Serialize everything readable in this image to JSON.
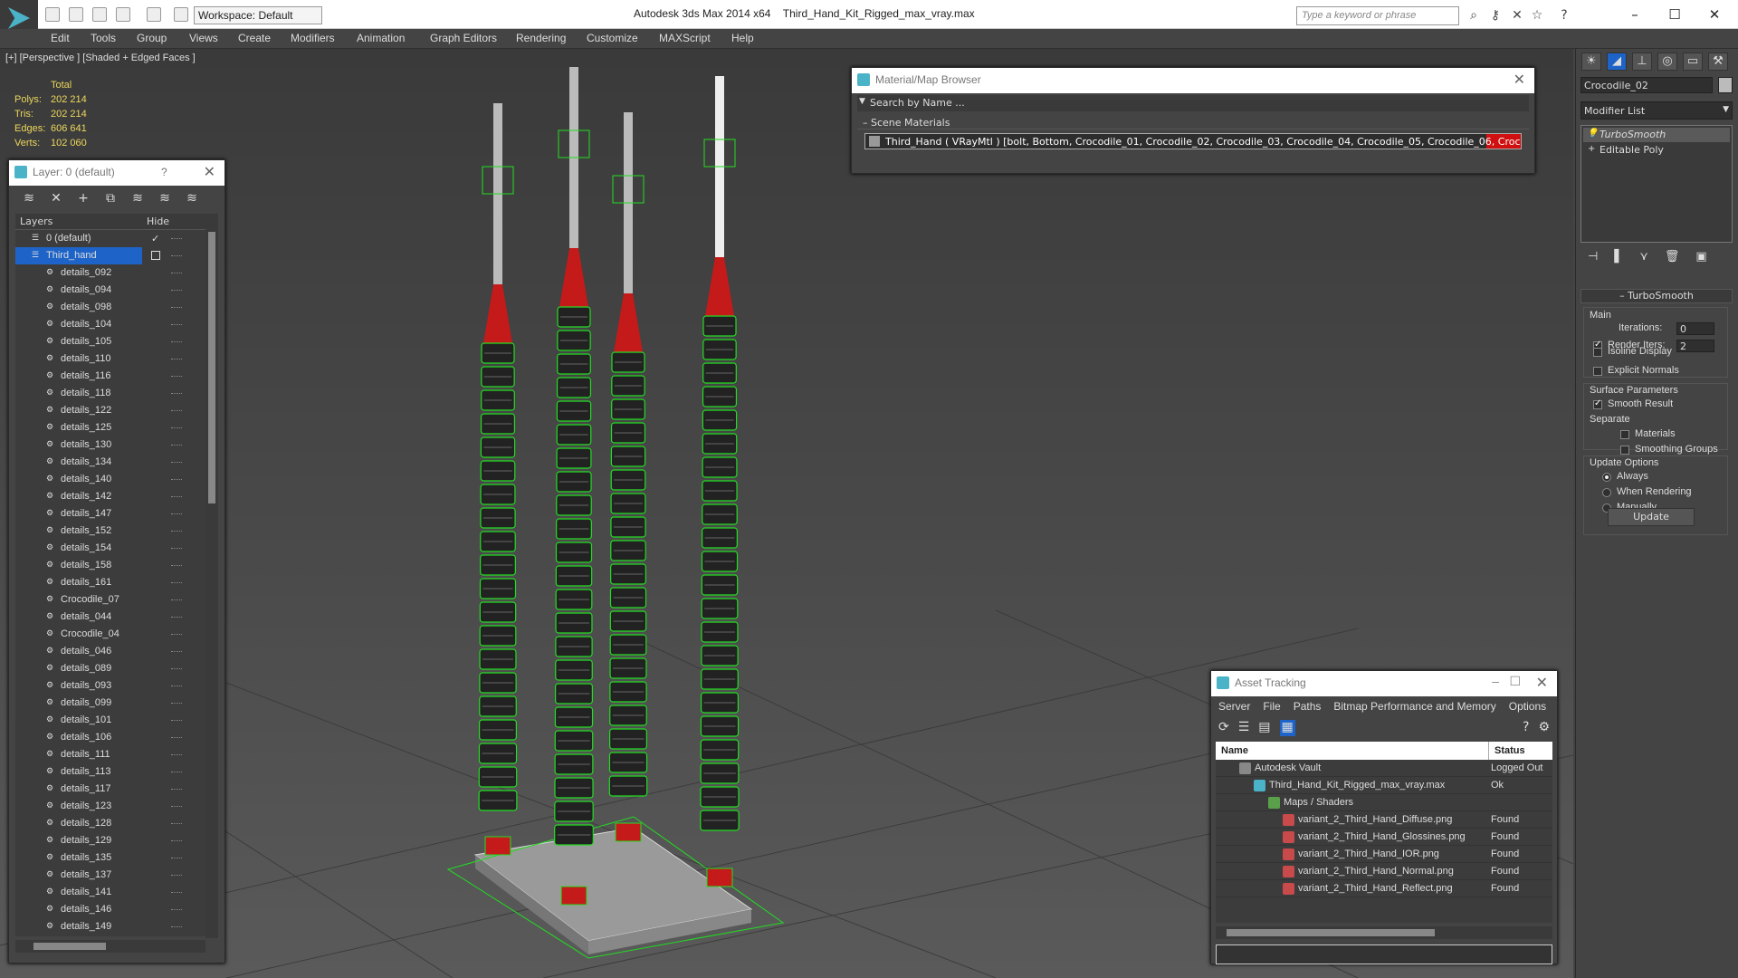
{
  "titlebar": {
    "workspace": "Workspace: Default",
    "app": "Autodesk 3ds Max 2014 x64",
    "file": "Third_Hand_Kit_Rigged_max_vray.max",
    "search_placeholder": "Type a keyword or phrase"
  },
  "menu": [
    "Edit",
    "Tools",
    "Group",
    "Views",
    "Create",
    "Modifiers",
    "Animation",
    "Graph Editors",
    "Rendering",
    "Customize",
    "MAXScript",
    "Help"
  ],
  "viewport": {
    "label": "[+] [Perspective ] [Shaded + Edged Faces ]",
    "stats": {
      "total_label": "Total",
      "rows": [
        {
          "k": "Polys:",
          "v": "202 214"
        },
        {
          "k": "Tris:",
          "v": "202 214"
        },
        {
          "k": "Edges:",
          "v": "606 641"
        },
        {
          "k": "Verts:",
          "v": "102 060"
        }
      ]
    }
  },
  "layer_panel": {
    "title": "Layer: 0 (default)",
    "help": "?",
    "col_layers": "Layers",
    "col_hide": "Hide",
    "items": [
      "0 (default)",
      "Third_hand",
      "details_092",
      "details_094",
      "details_098",
      "details_104",
      "details_105",
      "details_110",
      "details_116",
      "details_118",
      "details_122",
      "details_125",
      "details_130",
      "details_134",
      "details_140",
      "details_142",
      "details_147",
      "details_152",
      "details_154",
      "details_158",
      "details_161",
      "Crocodile_07",
      "details_044",
      "Crocodile_04",
      "details_046",
      "details_089",
      "details_093",
      "details_099",
      "details_101",
      "details_106",
      "details_111",
      "details_113",
      "details_117",
      "details_123",
      "details_128",
      "details_129",
      "details_135",
      "details_137",
      "details_141",
      "details_146",
      "details_149"
    ]
  },
  "material_browser": {
    "title": "Material/Map Browser",
    "search": "Search by Name ...",
    "section": "Scene Materials",
    "row": "Third_Hand ( VRayMtl ) [bolt, Bottom, Crocodile_01, Crocodile_02, Crocodile_03, Crocodile_04, Crocodile_05, Crocodile_06, Crocodile_0..."
  },
  "asset_tracking": {
    "title": "Asset Tracking",
    "menu": [
      "Server",
      "File",
      "Paths",
      "Bitmap Performance and Memory",
      "Options"
    ],
    "col_name": "Name",
    "col_status": "Status",
    "rows": [
      {
        "name": "Autodesk Vault",
        "status": "Logged Out",
        "indent": 1,
        "icon": "vault-icon"
      },
      {
        "name": "Third_Hand_Kit_Rigged_max_vray.max",
        "status": "Ok",
        "indent": 2,
        "icon": "max-file-icon"
      },
      {
        "name": "Maps / Shaders",
        "status": "",
        "indent": 3,
        "icon": "maps-folder-icon"
      },
      {
        "name": "variant_2_Third_Hand_Diffuse.png",
        "status": "Found",
        "indent": 4,
        "icon": "png-file-icon"
      },
      {
        "name": "variant_2_Third_Hand_Glossines.png",
        "status": "Found",
        "indent": 4,
        "icon": "png-file-icon"
      },
      {
        "name": "variant_2_Third_Hand_IOR.png",
        "status": "Found",
        "indent": 4,
        "icon": "png-file-icon"
      },
      {
        "name": "variant_2_Third_Hand_Normal.png",
        "status": "Found",
        "indent": 4,
        "icon": "png-file-icon"
      },
      {
        "name": "variant_2_Third_Hand_Reflect.png",
        "status": "Found",
        "indent": 4,
        "icon": "png-file-icon"
      }
    ]
  },
  "command_panel": {
    "object_name": "Crocodile_02",
    "modifier_list": "Modifier List",
    "stack": [
      "TurboSmooth",
      "Editable Poly"
    ],
    "turbosmooth": {
      "title": "TurboSmooth",
      "main": "Main",
      "iterations_label": "Iterations:",
      "iterations": "0",
      "render_iters_label": "Render Iters:",
      "render_iters": "2",
      "isoline": "Isoline Display",
      "explicit": "Explicit Normals",
      "surface": "Surface Parameters",
      "smooth": "Smooth Result",
      "separate": "Separate",
      "materials": "Materials",
      "smoothing_groups": "Smoothing Groups",
      "update_options": "Update Options",
      "always": "Always",
      "when_rendering": "When Rendering",
      "manually": "Manually",
      "update": "Update"
    }
  },
  "colors": {
    "accent": "#4ab3c7",
    "selection": "#1e64c8",
    "stats": "#ecd75c",
    "wire_green": "#22dd22",
    "wire_red": "#d01010"
  }
}
